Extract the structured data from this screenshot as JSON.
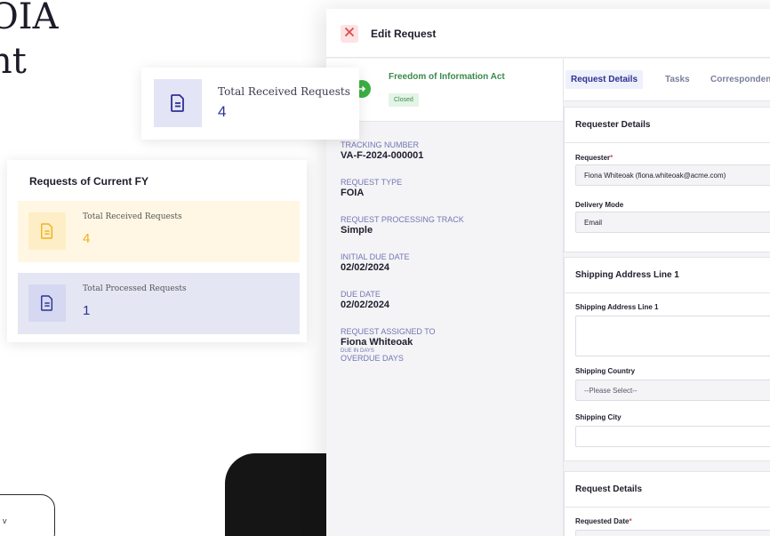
{
  "hero": {
    "line1": "OIA",
    "line2": "nt"
  },
  "outline_box": {
    "text": "v"
  },
  "float_card": {
    "label": "Total Received Requests",
    "value": "4",
    "icon": "document-icon"
  },
  "fy_card": {
    "title": "Requests of Current FY",
    "tiles": [
      {
        "label": "Total Received Requests",
        "value": "4",
        "color": "#f2b01e",
        "icon": "document-icon"
      },
      {
        "label": "Total Processed Requests",
        "value": "1",
        "color": "#2e3192",
        "icon": "document-icon"
      }
    ]
  },
  "modal": {
    "title": "Edit Request",
    "close_icon": "close-icon",
    "act": {
      "name": "Freedom of Information Act",
      "status": "Closed"
    },
    "info": {
      "tracking_label": "TRACKING NUMBER",
      "tracking_value": "VA-F-2024-000001",
      "type_label": "REQUEST TYPE",
      "type_value": "FOIA",
      "track_label": "REQUEST PROCESSING TRACK",
      "track_value": "Simple",
      "initial_due_label": "INITIAL DUE DATE",
      "initial_due_value": "02/02/2024",
      "due_label": "DUE DATE",
      "due_value": "02/02/2024",
      "assigned_label": "REQUEST ASSIGNED TO",
      "assigned_value": "Fiona Whiteoak",
      "due_in_days_label": "DUE IN DAYS",
      "overdue_label": "OVERDUE DAYS"
    },
    "tabs": [
      "Request Details",
      "Tasks",
      "Correspondence"
    ],
    "requester_section": {
      "title": "Requester Details",
      "requester_label": "Requester",
      "requester_value": "Fiona Whiteoak (fiona.whiteoak@acme.com)",
      "delivery_label": "Delivery Mode",
      "delivery_value": "Email"
    },
    "shipping_section": {
      "title": "Shipping Address Line 1",
      "address_label": "Shipping Address Line 1",
      "country_label": "Shipping Country",
      "country_value": "--Please Select--",
      "city_label": "Shipping City"
    },
    "request_section": {
      "title": "Request Details",
      "date_label": "Requested Date"
    },
    "colors": {
      "accent": "#2e3192",
      "yellow": "#f2b01e",
      "success": "#3cb043",
      "danger": "#e04848"
    }
  }
}
